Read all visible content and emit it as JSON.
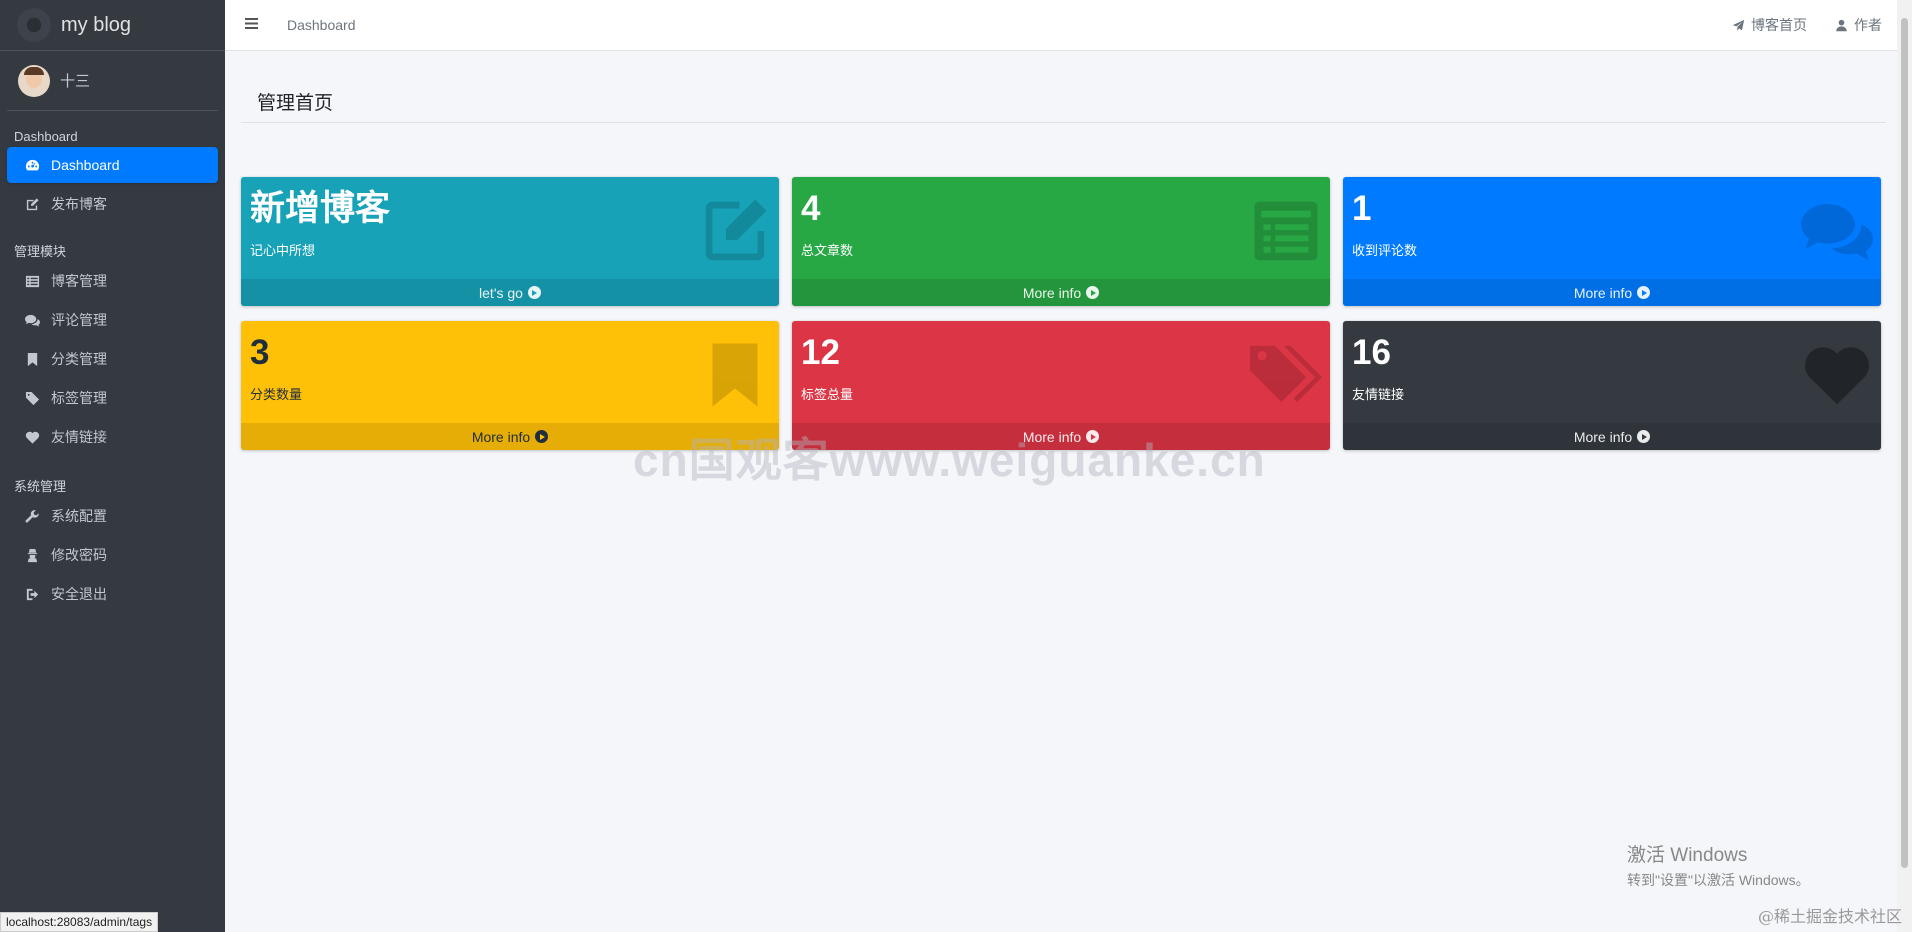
{
  "brand": {
    "name": "my blog"
  },
  "user": {
    "name": "十三"
  },
  "sidebar": {
    "sections": [
      {
        "header": "Dashboard",
        "items": [
          {
            "label": "Dashboard",
            "icon": "dashboard-icon",
            "active": true
          },
          {
            "label": "发布博客",
            "icon": "edit-icon"
          }
        ]
      },
      {
        "header": "管理模块",
        "items": [
          {
            "label": "博客管理",
            "icon": "list-icon"
          },
          {
            "label": "评论管理",
            "icon": "comments-icon"
          },
          {
            "label": "分类管理",
            "icon": "bookmark-icon"
          },
          {
            "label": "标签管理",
            "icon": "tags-icon"
          },
          {
            "label": "友情链接",
            "icon": "heart-icon"
          }
        ]
      },
      {
        "header": "系统管理",
        "items": [
          {
            "label": "系统配置",
            "icon": "wrench-icon"
          },
          {
            "label": "修改密码",
            "icon": "user-secret-icon"
          },
          {
            "label": "安全退出",
            "icon": "sign-out-icon"
          }
        ]
      }
    ]
  },
  "topbar": {
    "menu_icon": "hamburger-icon",
    "breadcrumb": "Dashboard",
    "right_links": [
      {
        "label": "博客首页",
        "icon": "paper-plane-icon"
      },
      {
        "label": "作者",
        "icon": "user-icon"
      }
    ]
  },
  "page": {
    "title": "管理首页"
  },
  "boxes": [
    {
      "value": "新增博客",
      "caption": "记心中所想",
      "footer": "let's go",
      "color": "#17a2b8",
      "icon": "edit-icon"
    },
    {
      "value": "4",
      "caption": "总文章数",
      "footer": "More info",
      "color": "#28a745",
      "icon": "list-alt-icon"
    },
    {
      "value": "1",
      "caption": "收到评论数",
      "footer": "More info",
      "color": "#007bff",
      "icon": "comments-icon"
    },
    {
      "value": "3",
      "caption": "分类数量",
      "footer": "More info",
      "color": "#ffc107",
      "icon": "bookmark-icon"
    },
    {
      "value": "12",
      "caption": "标签总量",
      "footer": "More info",
      "color": "#dc3545",
      "icon": "tags-icon"
    },
    {
      "value": "16",
      "caption": "友情链接",
      "footer": "More info",
      "color": "#343a40",
      "icon": "heart-icon"
    }
  ],
  "overlays": {
    "watermark": "cn国观客www.weiguanke.cn",
    "status_url": "localhost:28083/admin/tags",
    "windows_activate_title": "激活 Windows",
    "windows_activate_sub": "转到\"设置\"以激活 Windows。",
    "credit": "@稀土掘金技术社区"
  }
}
